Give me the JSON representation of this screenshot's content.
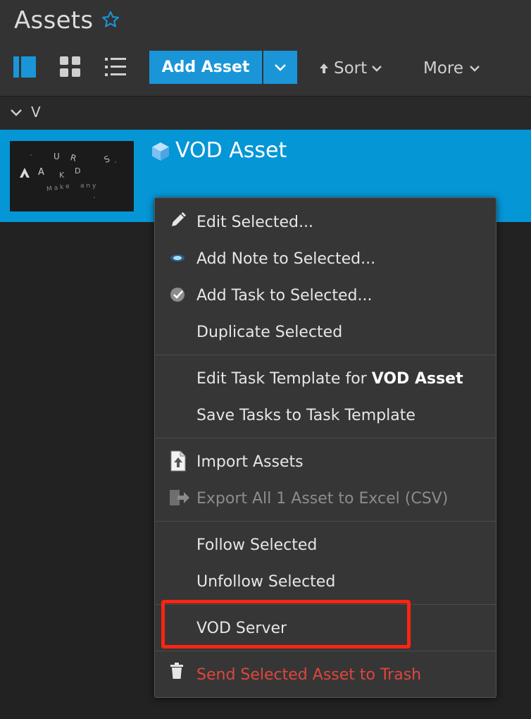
{
  "header": {
    "title": "Assets",
    "star_icon": "star-outline-icon",
    "view_modes": [
      "list-detail-icon",
      "grid-icon",
      "list-icon"
    ],
    "add_button_label": "Add Asset",
    "sort_label": "Sort",
    "more_label": "More"
  },
  "group": {
    "label": "V"
  },
  "asset": {
    "name": "VOD Asset",
    "thumbnail_text": "AUTODESK"
  },
  "context_menu": {
    "edit_selected": "Edit Selected...",
    "add_note": "Add Note to Selected...",
    "add_task": "Add Task to Selected...",
    "duplicate": "Duplicate Selected",
    "edit_task_template_prefix": "Edit Task Template for ",
    "edit_task_template_target": "VOD Asset",
    "save_tasks": "Save Tasks to Task Template",
    "import_assets": "Import Assets",
    "export_assets": "Export All 1 Asset to Excel (CSV)",
    "follow": "Follow Selected",
    "unfollow": "Unfollow Selected",
    "vod_server": "VOD Server",
    "trash": "Send Selected Asset to Trash"
  },
  "colors": {
    "accent": "#1a96d8",
    "selection": "#0596d6",
    "danger": "#e0463c",
    "highlight": "#ff2412"
  }
}
